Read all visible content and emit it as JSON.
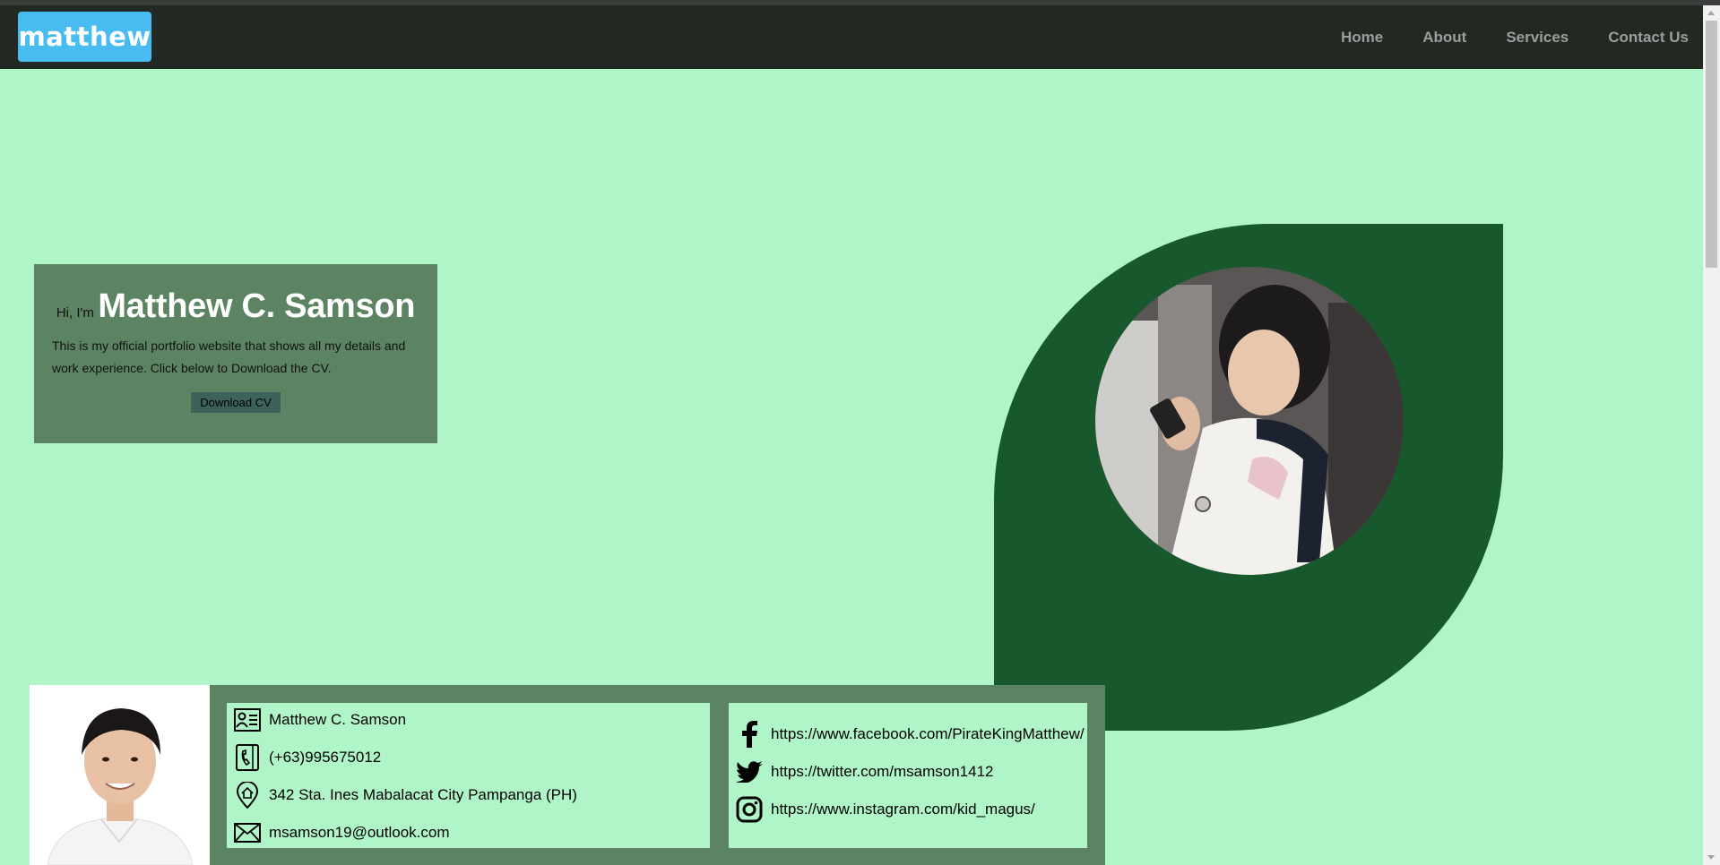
{
  "header": {
    "logo_text": "matthew",
    "nav": [
      "Home",
      "About",
      "Services",
      "Contact Us"
    ]
  },
  "hero": {
    "greeting": "Hi, I'm",
    "name": "Matthew C. Samson",
    "description": "This is my official portfolio website that shows all my details and work experience. Click below to Download the CV.",
    "download_label": "Download CV"
  },
  "contact": {
    "name": "Matthew C. Samson",
    "phone": "(+63)995675012",
    "address": "342 Sta. Ines Mabalacat City Pampanga (PH)",
    "email": "msamson19@outlook.com"
  },
  "social": {
    "facebook": "https://www.facebook.com/PirateKingMatthew/",
    "twitter": "https://twitter.com/msamson1412",
    "instagram": "https://www.instagram.com/kid_magus/"
  },
  "icons": {
    "contact": [
      "id-card-icon",
      "phone-icon",
      "home-location-icon",
      "envelope-icon"
    ],
    "social": [
      "facebook-icon",
      "twitter-icon",
      "instagram-icon"
    ]
  },
  "colors": {
    "page_bg": "#b0f5c7",
    "navbar_bg": "#222822",
    "logo_bg": "#48bcf0",
    "nav_text": "#9d9d9d",
    "panel_bg": "#5c8462",
    "blob": "#17592d",
    "button_bg": "#3d625a"
  }
}
